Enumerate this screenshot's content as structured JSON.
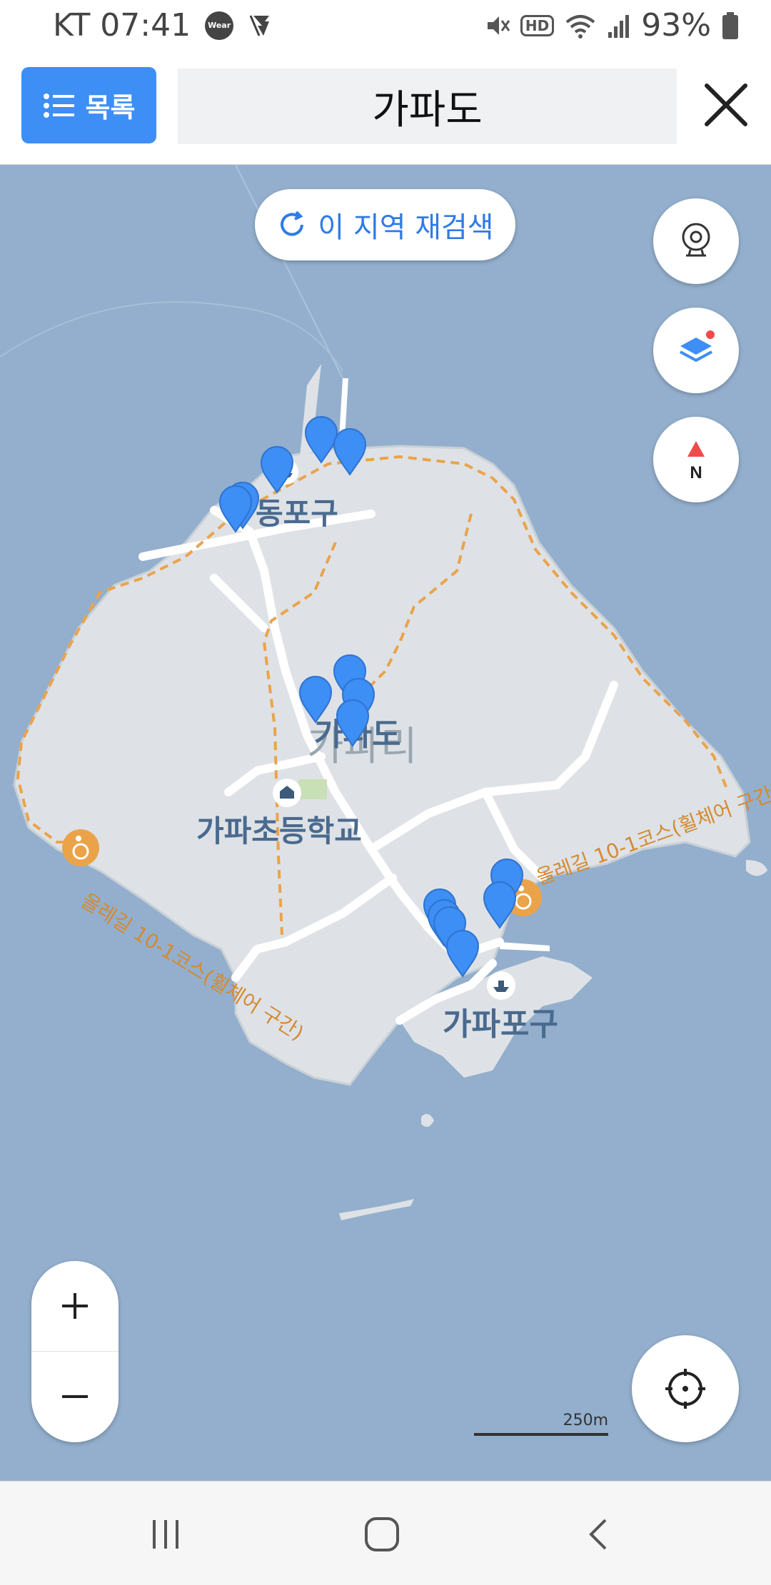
{
  "status_bar": {
    "carrier_time": "KT 07:41",
    "wear_badge": "Wear",
    "hd_badge": "HD",
    "battery_percent": "93%",
    "icons": [
      "wear-icon",
      "flash-icon",
      "mute-icon",
      "hd-icon",
      "wifi-icon",
      "signal-icon",
      "battery-icon"
    ]
  },
  "header": {
    "list_button_label": "목록",
    "search_query": "가파도",
    "icons": [
      "list-icon",
      "close-icon"
    ]
  },
  "map": {
    "research_label": "이 지역 재검색",
    "labels": {
      "dongpogu": "동포구",
      "gapado": "가파도",
      "gapari": "가파리",
      "school": "가파초등학교",
      "gapapogu": "가파포구",
      "olle_left": "올레길 10-1코스(휠체어 구간)",
      "olle_right": "올레길 10-1코스(휠체어 구간)"
    },
    "scale_label": "250m",
    "pin_count": 15,
    "accent_color": "#3d8ef5",
    "route_color": "#eba34a",
    "icons": [
      "street-view-icon",
      "layers-icon",
      "compass-north-icon",
      "zoom-in-icon",
      "zoom-out-icon",
      "my-location-icon",
      "ferry-icon",
      "school-icon",
      "wheelchair-icon",
      "refresh-icon"
    ]
  },
  "nav_bar": {
    "icons": [
      "recent-apps-icon",
      "home-icon",
      "back-icon"
    ]
  }
}
